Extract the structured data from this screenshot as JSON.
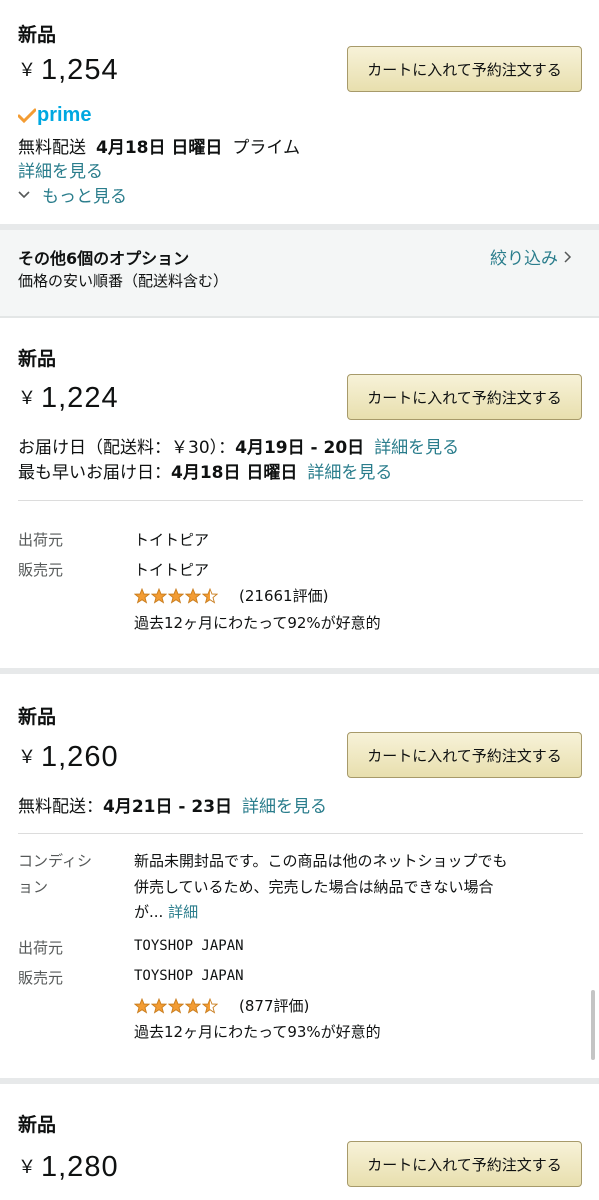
{
  "featured": {
    "condition": "新品",
    "currency": "￥",
    "price": "1,254",
    "cart_button": "カートに入れて予約注文する",
    "prime_logo": "prime",
    "delivery_prefix": "無料配送",
    "delivery_date": "4月18日 日曜日",
    "delivery_suffix": "プライム",
    "details_link": "詳細を見る",
    "more_link": "もっと見る"
  },
  "options_header": {
    "title": "その他6個のオプション",
    "sort": "価格の安い順番（配送料含む）",
    "filter_link": "絞り込み",
    "chevron_right_icon": "chevron-right-icon"
  },
  "offers": [
    {
      "condition": "新品",
      "price": "1,224",
      "cart_button": "カートに入れて予約注文する",
      "delivery1_prefix": "お届け日（配送料：￥30）：",
      "delivery1_date": "4月19日 - 20日",
      "delivery1_link": "詳細を見る",
      "delivery2_prefix": "最も早いお届け日：",
      "delivery2_date": "4月18日 日曜日",
      "delivery2_link": "詳細を見る",
      "ships_from_label": "出荷元",
      "ships_from": "トイトピア",
      "sold_by_label": "販売元",
      "sold_by": "トイトピア",
      "rating_stars": 4.5,
      "rating_count": "(21661評価)",
      "positive": "過去12ヶ月にわたって92%が好意的"
    },
    {
      "condition": "新品",
      "price": "1,260",
      "cart_button": "カートに入れて予約注文する",
      "delivery1_prefix": "無料配送：",
      "delivery1_date": "4月21日 - 23日",
      "delivery1_link": "詳細を見る",
      "condition_label_1": "コンディシ",
      "condition_label_2": "ョン",
      "condition_note_1": "新品未開封品です。この商品は他のネットショップでも",
      "condition_note_2": "併売しているため、完売した場合は納品できない場合",
      "condition_note_3": "が...",
      "condition_more": "詳細",
      "ships_from_label": "出荷元",
      "ships_from": "TOYSHOP JAPAN",
      "sold_by_label": "販売元",
      "sold_by": "TOYSHOP JAPAN",
      "rating_stars": 4.5,
      "rating_count": "(877評価)",
      "positive": "過去12ヶ月にわたって93%が好意的"
    },
    {
      "condition": "新品",
      "price": "1,280",
      "cart_button": "カートに入れて予約注文する"
    }
  ],
  "colors": {
    "link": "#2a7d8c",
    "star": "#f39c33",
    "prime": "#00a8e1"
  }
}
